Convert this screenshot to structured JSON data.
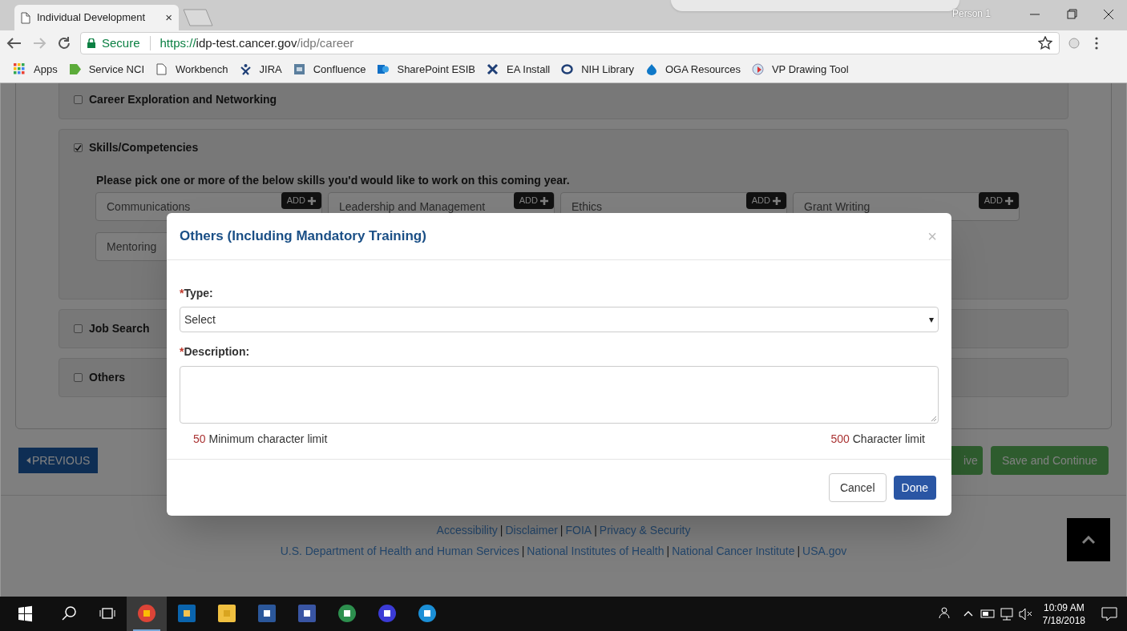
{
  "browser": {
    "tab_title": "Individual Development",
    "tab_close": "×",
    "profile": "Person 1",
    "secure_label": "Secure",
    "url_scheme": "https://",
    "url_host": "idp-test.cancer.gov",
    "url_path": "/idp/career",
    "bookmarks": [
      {
        "label": "Apps"
      },
      {
        "label": "Service NCI"
      },
      {
        "label": "Workbench"
      },
      {
        "label": "JIRA"
      },
      {
        "label": "Confluence"
      },
      {
        "label": "SharePoint ESIB"
      },
      {
        "label": "EA Install"
      },
      {
        "label": "NIH Library"
      },
      {
        "label": "OGA Resources"
      },
      {
        "label": "VP Drawing Tool"
      }
    ]
  },
  "page": {
    "sections": [
      {
        "kind": "plain",
        "label": "Career Exploration and Networking",
        "checked": false
      },
      {
        "kind": "skills",
        "label": "Skills/Competencies",
        "checked": true,
        "prompt": "Please pick one or more of the below skills you'd would like to work on this coming year.",
        "skills": [
          {
            "name": "Communications",
            "button": "ADD"
          },
          {
            "name": "Leadership and Management",
            "button": "ADD"
          },
          {
            "name": "Ethics",
            "button": "ADD"
          },
          {
            "name": "Grant Writing",
            "button": "ADD"
          },
          {
            "name": "Mentoring"
          }
        ]
      },
      {
        "kind": "plain",
        "label": "Job Search",
        "checked": false
      },
      {
        "kind": "plain",
        "label": "Others",
        "checked": false
      }
    ],
    "previous_button": "PREVIOUS",
    "hidden_button_tail": "ive",
    "save_continue_button": "Save and Continue",
    "footer_lines": [
      [
        "Accessibility",
        "Disclaimer",
        "FOIA",
        "Privacy & Security"
      ],
      [
        "U.S. Department of Health and Human Services",
        "National Institutes of Health",
        "National Cancer Institute",
        "USA.gov"
      ]
    ],
    "footer_separator": "|"
  },
  "modal": {
    "title": "Others (Including Mandatory Training)",
    "close": "×",
    "fields": [
      {
        "kind": "select",
        "required_mark": "*",
        "label": "Type:",
        "value": "Select",
        "arrow": "▾"
      },
      {
        "kind": "textarea",
        "required_mark": "*",
        "label": "Description:"
      }
    ],
    "min_count": "50",
    "min_text": "Minimum character limit",
    "max_count": "500",
    "max_text": "Character limit",
    "buttons": [
      {
        "label": "Cancel",
        "kind": "default"
      },
      {
        "label": "Done",
        "kind": "primary"
      }
    ]
  },
  "taskbar": {
    "time": "10:09 AM",
    "date": "7/18/2018"
  }
}
